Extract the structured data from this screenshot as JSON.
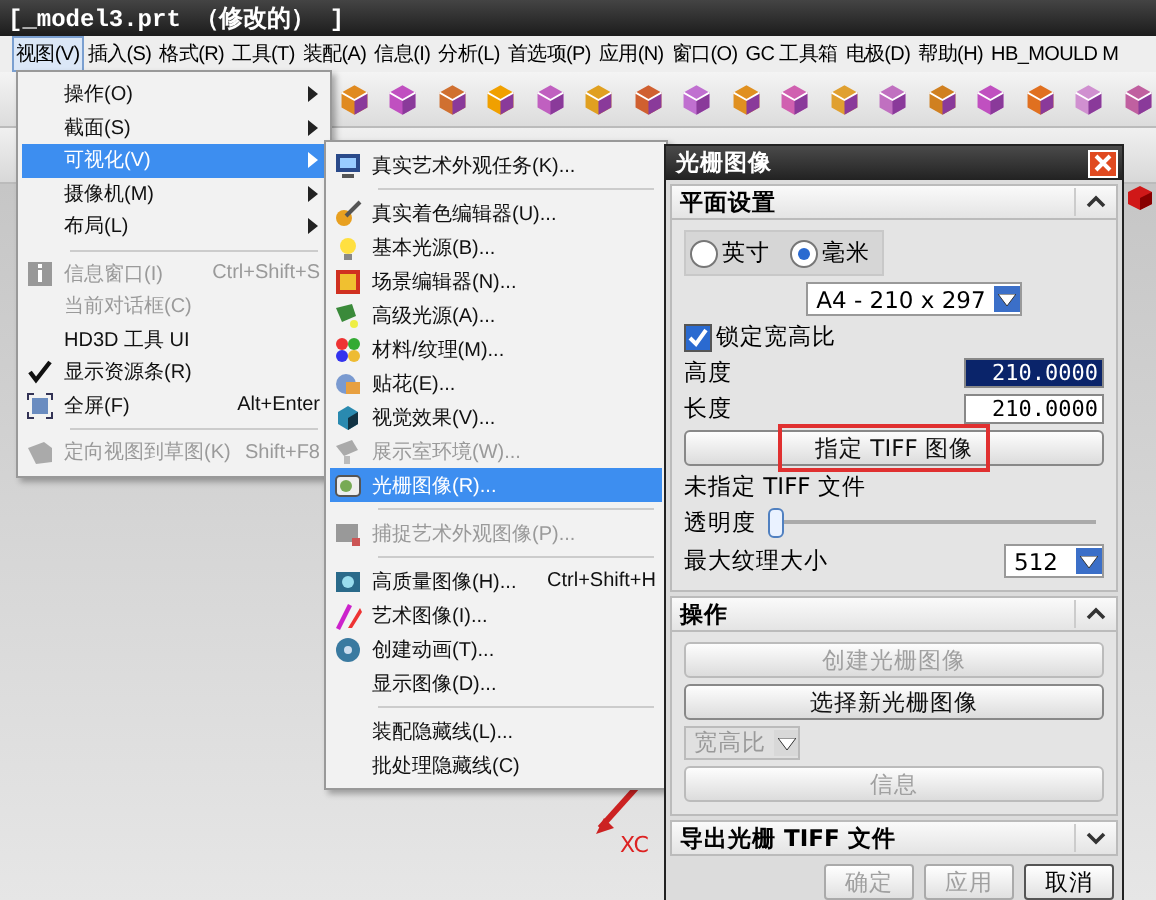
{
  "window": {
    "title": "[_model3.prt （修改的） ]"
  },
  "menu_bar": [
    {
      "label": "视图(V)",
      "selected": true
    },
    {
      "label": "插入(S)",
      "selected": false
    },
    {
      "label": "格式(R)",
      "selected": false
    },
    {
      "label": "工具(T)",
      "selected": false
    },
    {
      "label": "装配(A)",
      "selected": false
    },
    {
      "label": "信息(I)",
      "selected": false
    },
    {
      "label": "分析(L)",
      "selected": false
    },
    {
      "label": "首选项(P)",
      "selected": false
    },
    {
      "label": "应用(N)",
      "selected": false
    },
    {
      "label": "窗口(O)",
      "selected": false
    },
    {
      "label": "GC 工具箱",
      "selected": false
    },
    {
      "label": "电极(D)",
      "selected": false
    },
    {
      "label": "帮助(H)",
      "selected": false
    },
    {
      "label": "HB_MOULD M",
      "selected": false
    }
  ],
  "viewport": {
    "axis_label": "XC"
  },
  "view_menu": [
    {
      "kind": "submenu",
      "label": "操作(O)",
      "selected": false,
      "disabled": false,
      "checked": false
    },
    {
      "kind": "submenu",
      "label": "截面(S)",
      "selected": false,
      "disabled": false,
      "checked": false
    },
    {
      "kind": "submenu",
      "label": "可视化(V)",
      "selected": true,
      "disabled": false,
      "checked": false
    },
    {
      "kind": "submenu",
      "label": "摄像机(M)",
      "selected": false,
      "disabled": false,
      "checked": false
    },
    {
      "kind": "submenu",
      "label": "布局(L)",
      "selected": false,
      "disabled": false,
      "checked": false
    },
    {
      "kind": "separator"
    },
    {
      "kind": "item",
      "label": "信息窗口(I)",
      "shortcut": "Ctrl+Shift+S",
      "selected": false,
      "disabled": true,
      "checked": false
    },
    {
      "kind": "item",
      "label": "当前对话框(C)",
      "selected": false,
      "disabled": true,
      "checked": false
    },
    {
      "kind": "item",
      "label": "HD3D 工具 UI",
      "selected": false,
      "disabled": false,
      "checked": false
    },
    {
      "kind": "item",
      "label": "显示资源条(R)",
      "selected": false,
      "disabled": false,
      "checked": true
    },
    {
      "kind": "item",
      "label": "全屏(F)",
      "shortcut": "Alt+Enter",
      "selected": false,
      "disabled": false,
      "checked": false
    },
    {
      "kind": "separator"
    },
    {
      "kind": "item",
      "label": "定向视图到草图(K)",
      "shortcut": "Shift+F8",
      "selected": false,
      "disabled": true,
      "checked": false
    }
  ],
  "visualization_menu": [
    {
      "kind": "item",
      "label": "真实艺术外观任务(K)...",
      "selected": false,
      "disabled": false
    },
    {
      "kind": "separator"
    },
    {
      "kind": "item",
      "label": "真实着色编辑器(U)...",
      "selected": false,
      "disabled": false
    },
    {
      "kind": "item",
      "label": "基本光源(B)...",
      "selected": false,
      "disabled": false
    },
    {
      "kind": "item",
      "label": "场景编辑器(N)...",
      "selected": false,
      "disabled": false
    },
    {
      "kind": "item",
      "label": "高级光源(A)...",
      "selected": false,
      "disabled": false
    },
    {
      "kind": "item",
      "label": "材料/纹理(M)...",
      "selected": false,
      "disabled": false
    },
    {
      "kind": "item",
      "label": "贴花(E)...",
      "selected": false,
      "disabled": false
    },
    {
      "kind": "item",
      "label": "视觉效果(V)...",
      "selected": false,
      "disabled": false
    },
    {
      "kind": "item",
      "label": "展示室环境(W)...",
      "selected": false,
      "disabled": true
    },
    {
      "kind": "item",
      "label": "光栅图像(R)...",
      "selected": true,
      "disabled": false
    },
    {
      "kind": "separator"
    },
    {
      "kind": "item",
      "label": "捕捉艺术外观图像(P)...",
      "selected": false,
      "disabled": true
    },
    {
      "kind": "separator"
    },
    {
      "kind": "item",
      "label": "高质量图像(H)...",
      "shortcut": "Ctrl+Shift+H",
      "selected": false,
      "disabled": false
    },
    {
      "kind": "item",
      "label": "艺术图像(I)...",
      "selected": false,
      "disabled": false
    },
    {
      "kind": "item",
      "label": "创建动画(T)...",
      "selected": false,
      "disabled": false
    },
    {
      "kind": "item",
      "label": "显示图像(D)...",
      "selected": false,
      "disabled": false
    },
    {
      "kind": "separator"
    },
    {
      "kind": "item",
      "label": "装配隐藏线(L)...",
      "selected": false,
      "disabled": false
    },
    {
      "kind": "item",
      "label": "批处理隐藏线(C)",
      "selected": false,
      "disabled": false
    }
  ],
  "dialog": {
    "title": "光栅图像",
    "sections": [
      {
        "title": "平面设置",
        "expanded": true,
        "rows": [
          {
            "kind": "radio_group",
            "options": [
              {
                "label": "英寸",
                "selected": false
              },
              {
                "label": "毫米",
                "selected": true
              }
            ]
          },
          {
            "kind": "dropdown",
            "value": "A4 - 210 x 297",
            "disabled": false
          },
          {
            "kind": "checkbox",
            "label": "锁定宽高比",
            "checked": true
          },
          {
            "kind": "field",
            "label": "高度",
            "value": "210.0000",
            "selected": true
          },
          {
            "kind": "field",
            "label": "长度",
            "value": "210.0000",
            "selected": false
          },
          {
            "kind": "button",
            "label": "指定 TIFF 图像",
            "disabled": false,
            "highlighted": true
          },
          {
            "kind": "text",
            "text": "未指定 TIFF 文件"
          },
          {
            "kind": "slider",
            "label": "透明度",
            "level": 0
          },
          {
            "kind": "labeled_dropdown",
            "label": "最大纹理大小",
            "value": "512"
          }
        ]
      },
      {
        "title": "操作",
        "expanded": true,
        "rows": [
          {
            "kind": "button",
            "label": "创建光栅图像",
            "disabled": true,
            "highlighted": false
          },
          {
            "kind": "button",
            "label": "选择新光栅图像",
            "disabled": false,
            "highlighted": false
          },
          {
            "kind": "dropdown",
            "value": "宽高比",
            "disabled": true
          },
          {
            "kind": "button",
            "label": "信息",
            "disabled": true,
            "highlighted": false
          }
        ]
      },
      {
        "title": "导出光栅 TIFF 文件",
        "expanded": false
      }
    ],
    "buttons": [
      {
        "label": "确定",
        "disabled": true
      },
      {
        "label": "应用",
        "disabled": true
      },
      {
        "label": "取消",
        "disabled": false
      }
    ]
  }
}
